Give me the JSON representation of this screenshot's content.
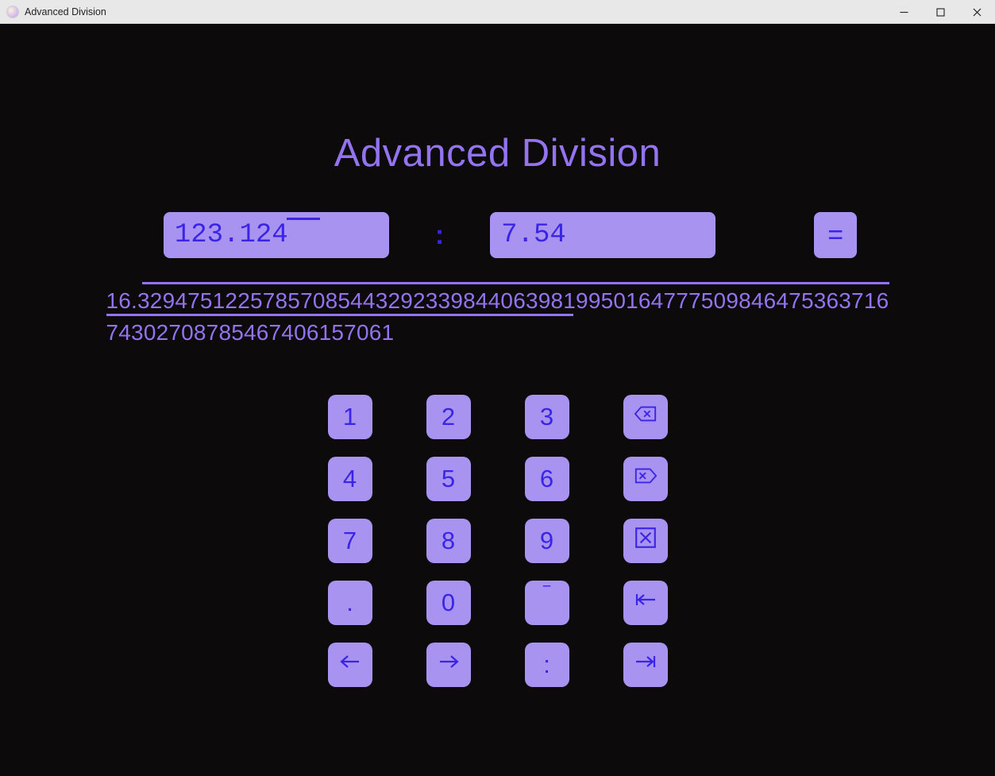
{
  "window": {
    "title": "Advanced Division"
  },
  "header": {
    "title": "Advanced Division"
  },
  "inputs": {
    "dividend": "123.124",
    "divisor": "7.54",
    "operator": ":",
    "equals": "="
  },
  "result": {
    "line1": "16.3294751225785708544329233984406398199501647775098464753",
    "line2": "6371674302708785467406157061"
  },
  "keypad": {
    "k1": "1",
    "k2": "2",
    "k3": "3",
    "k4": "4",
    "k5": "5",
    "k6": "6",
    "k7": "7",
    "k8": "8",
    "k9": "9",
    "kdot": ".",
    "k0": "0",
    "koverline": "‾",
    "kcolon": ":"
  }
}
